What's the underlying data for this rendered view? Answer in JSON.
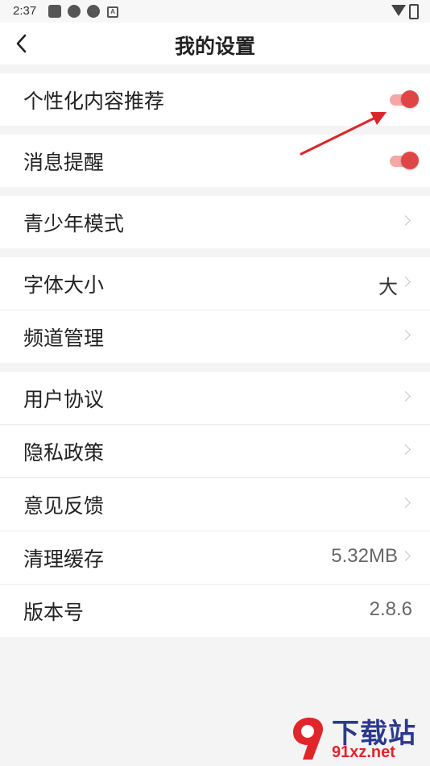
{
  "status_bar": {
    "time": "2:37"
  },
  "header": {
    "title": "我的设置",
    "back_icon": "chevron-left-icon"
  },
  "settings": {
    "personalized": {
      "label": "个性化内容推荐",
      "enabled": true
    },
    "notifications": {
      "label": "消息提醒",
      "enabled": true
    },
    "teen_mode": {
      "label": "青少年模式"
    },
    "font_size": {
      "label": "字体大小",
      "value": "大"
    },
    "channel_manage": {
      "label": "频道管理"
    },
    "user_agreement": {
      "label": "用户协议"
    },
    "privacy_policy": {
      "label": "隐私政策"
    },
    "feedback": {
      "label": "意见反馈"
    },
    "clear_cache": {
      "label": "清理缓存",
      "value": "5.32MB"
    },
    "version": {
      "label": "版本号",
      "value": "2.8.6"
    }
  },
  "watermark": {
    "name": "下载站",
    "url": "91xz.net"
  },
  "colors": {
    "accent": "#e04545",
    "track": "#f4a7a6",
    "background": "#f4f4f4"
  }
}
